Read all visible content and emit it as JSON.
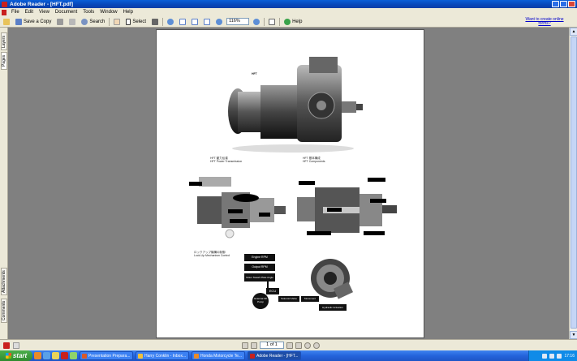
{
  "window": {
    "title": "Adobe Reader - [HFT.pdf]"
  },
  "menu": [
    "File",
    "Edit",
    "View",
    "Document",
    "Tools",
    "Window",
    "Help"
  ],
  "toolbar": {
    "save_copy": "Save a Copy",
    "search": "Search",
    "select": "Select",
    "zoom": "116%",
    "help": "Help",
    "help_link": "Want to create online forms?"
  },
  "nav_tabs": [
    "Layers",
    "Pages",
    "Attachments",
    "Comments"
  ],
  "document": {
    "hft_label": "HFT",
    "section1_jp": "HFT 動力伝達",
    "section1_en": "HFT Power Transmission",
    "section2_jp": "HFT 基本構成",
    "section2_en": "HFT Components",
    "section3_jp": "ロックアップ機構の制御",
    "section3_en": "Lock-Up Mechanism Control",
    "flow": {
      "engine_rpm": "Engine RPM",
      "output_rpm": "Output RPM",
      "motor_angle": "Motor Swash Plate Angle",
      "ecu": "ECU",
      "ext_pump": "External Oil Pump",
      "solenoid": "Solenoid Valve",
      "movement": "Movement",
      "hydraulic": "Hydraulic Actuation"
    }
  },
  "pager": {
    "value": "1 of 1"
  },
  "taskbar": {
    "start": "start",
    "tasks": [
      "Presentation Prepara...",
      "Harry Conklin - Inbox...",
      "Honda Motorcycle Te...",
      "Adobe Reader - [HFT..."
    ],
    "clock": "17:16"
  },
  "colors": {
    "title_blue": "#0a5fd8",
    "taskbar_blue": "#2463db",
    "start_green": "#2f8b2f",
    "reader_red": "#c9201d"
  }
}
